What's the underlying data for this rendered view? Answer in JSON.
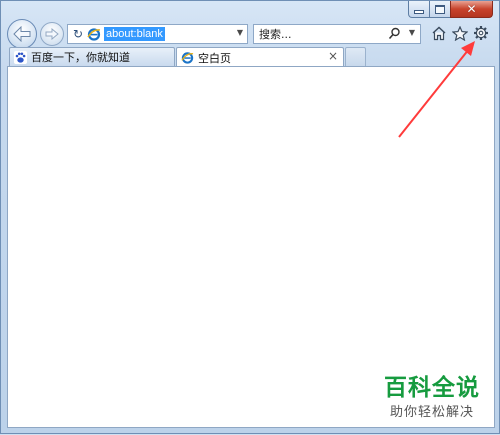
{
  "window": {
    "close_glyph": "✕"
  },
  "address_bar": {
    "url": "about:blank",
    "refresh_glyph": "↻",
    "dropdown_glyph": "▼"
  },
  "search_bar": {
    "placeholder": "搜索...",
    "dropdown_glyph": "▼"
  },
  "tabs": [
    {
      "label": "百度一下，你就知道",
      "active": false
    },
    {
      "label": "空白页",
      "active": true,
      "close_glyph": "×"
    }
  ],
  "command_icons": [
    "home-icon",
    "favorites-star-icon",
    "tools-gear-icon"
  ],
  "colors": {
    "ie_blue": "#1a73c7",
    "url_highlight": "#3399ff",
    "arrow": "#ff3b3b",
    "watermark_green": "#169b3f"
  },
  "watermark": {
    "title": "百科全说",
    "subtitle": "助你轻松解决"
  }
}
